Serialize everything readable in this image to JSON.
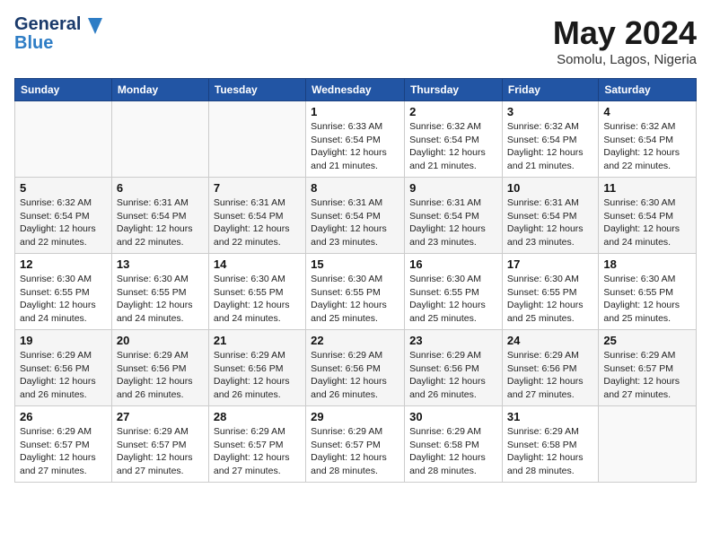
{
  "header": {
    "logo_line1": "General",
    "logo_line2": "Blue",
    "title": "May 2024",
    "subtitle": "Somolu, Lagos, Nigeria"
  },
  "calendar": {
    "days_of_week": [
      "Sunday",
      "Monday",
      "Tuesday",
      "Wednesday",
      "Thursday",
      "Friday",
      "Saturday"
    ],
    "weeks": [
      [
        {
          "day": "",
          "info": ""
        },
        {
          "day": "",
          "info": ""
        },
        {
          "day": "",
          "info": ""
        },
        {
          "day": "1",
          "info": "Sunrise: 6:33 AM\nSunset: 6:54 PM\nDaylight: 12 hours\nand 21 minutes."
        },
        {
          "day": "2",
          "info": "Sunrise: 6:32 AM\nSunset: 6:54 PM\nDaylight: 12 hours\nand 21 minutes."
        },
        {
          "day": "3",
          "info": "Sunrise: 6:32 AM\nSunset: 6:54 PM\nDaylight: 12 hours\nand 21 minutes."
        },
        {
          "day": "4",
          "info": "Sunrise: 6:32 AM\nSunset: 6:54 PM\nDaylight: 12 hours\nand 22 minutes."
        }
      ],
      [
        {
          "day": "5",
          "info": "Sunrise: 6:32 AM\nSunset: 6:54 PM\nDaylight: 12 hours\nand 22 minutes."
        },
        {
          "day": "6",
          "info": "Sunrise: 6:31 AM\nSunset: 6:54 PM\nDaylight: 12 hours\nand 22 minutes."
        },
        {
          "day": "7",
          "info": "Sunrise: 6:31 AM\nSunset: 6:54 PM\nDaylight: 12 hours\nand 22 minutes."
        },
        {
          "day": "8",
          "info": "Sunrise: 6:31 AM\nSunset: 6:54 PM\nDaylight: 12 hours\nand 23 minutes."
        },
        {
          "day": "9",
          "info": "Sunrise: 6:31 AM\nSunset: 6:54 PM\nDaylight: 12 hours\nand 23 minutes."
        },
        {
          "day": "10",
          "info": "Sunrise: 6:31 AM\nSunset: 6:54 PM\nDaylight: 12 hours\nand 23 minutes."
        },
        {
          "day": "11",
          "info": "Sunrise: 6:30 AM\nSunset: 6:54 PM\nDaylight: 12 hours\nand 24 minutes."
        }
      ],
      [
        {
          "day": "12",
          "info": "Sunrise: 6:30 AM\nSunset: 6:55 PM\nDaylight: 12 hours\nand 24 minutes."
        },
        {
          "day": "13",
          "info": "Sunrise: 6:30 AM\nSunset: 6:55 PM\nDaylight: 12 hours\nand 24 minutes."
        },
        {
          "day": "14",
          "info": "Sunrise: 6:30 AM\nSunset: 6:55 PM\nDaylight: 12 hours\nand 24 minutes."
        },
        {
          "day": "15",
          "info": "Sunrise: 6:30 AM\nSunset: 6:55 PM\nDaylight: 12 hours\nand 25 minutes."
        },
        {
          "day": "16",
          "info": "Sunrise: 6:30 AM\nSunset: 6:55 PM\nDaylight: 12 hours\nand 25 minutes."
        },
        {
          "day": "17",
          "info": "Sunrise: 6:30 AM\nSunset: 6:55 PM\nDaylight: 12 hours\nand 25 minutes."
        },
        {
          "day": "18",
          "info": "Sunrise: 6:30 AM\nSunset: 6:55 PM\nDaylight: 12 hours\nand 25 minutes."
        }
      ],
      [
        {
          "day": "19",
          "info": "Sunrise: 6:29 AM\nSunset: 6:56 PM\nDaylight: 12 hours\nand 26 minutes."
        },
        {
          "day": "20",
          "info": "Sunrise: 6:29 AM\nSunset: 6:56 PM\nDaylight: 12 hours\nand 26 minutes."
        },
        {
          "day": "21",
          "info": "Sunrise: 6:29 AM\nSunset: 6:56 PM\nDaylight: 12 hours\nand 26 minutes."
        },
        {
          "day": "22",
          "info": "Sunrise: 6:29 AM\nSunset: 6:56 PM\nDaylight: 12 hours\nand 26 minutes."
        },
        {
          "day": "23",
          "info": "Sunrise: 6:29 AM\nSunset: 6:56 PM\nDaylight: 12 hours\nand 26 minutes."
        },
        {
          "day": "24",
          "info": "Sunrise: 6:29 AM\nSunset: 6:56 PM\nDaylight: 12 hours\nand 27 minutes."
        },
        {
          "day": "25",
          "info": "Sunrise: 6:29 AM\nSunset: 6:57 PM\nDaylight: 12 hours\nand 27 minutes."
        }
      ],
      [
        {
          "day": "26",
          "info": "Sunrise: 6:29 AM\nSunset: 6:57 PM\nDaylight: 12 hours\nand 27 minutes."
        },
        {
          "day": "27",
          "info": "Sunrise: 6:29 AM\nSunset: 6:57 PM\nDaylight: 12 hours\nand 27 minutes."
        },
        {
          "day": "28",
          "info": "Sunrise: 6:29 AM\nSunset: 6:57 PM\nDaylight: 12 hours\nand 27 minutes."
        },
        {
          "day": "29",
          "info": "Sunrise: 6:29 AM\nSunset: 6:57 PM\nDaylight: 12 hours\nand 28 minutes."
        },
        {
          "day": "30",
          "info": "Sunrise: 6:29 AM\nSunset: 6:58 PM\nDaylight: 12 hours\nand 28 minutes."
        },
        {
          "day": "31",
          "info": "Sunrise: 6:29 AM\nSunset: 6:58 PM\nDaylight: 12 hours\nand 28 minutes."
        },
        {
          "day": "",
          "info": ""
        }
      ]
    ]
  }
}
